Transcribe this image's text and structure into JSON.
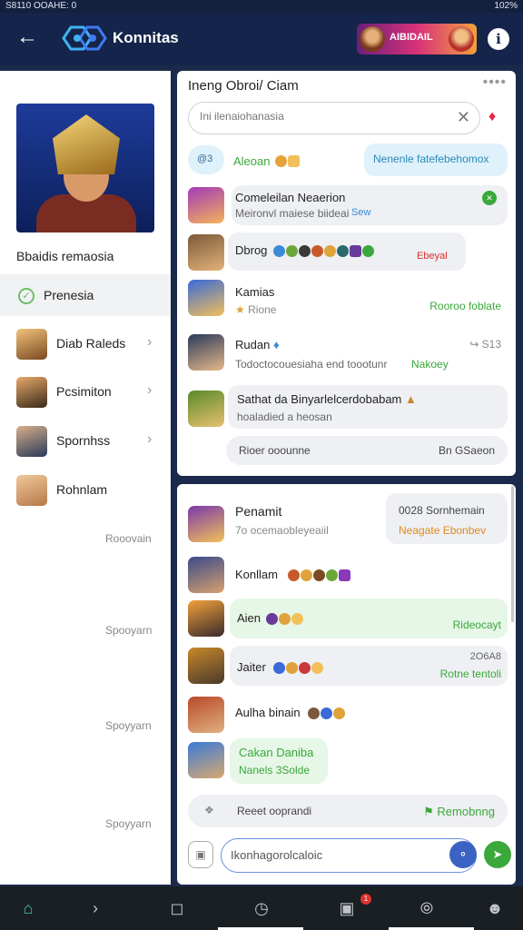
{
  "status_bar": {
    "left": "S8110 OOAHE: 0",
    "right": "102%"
  },
  "app_bar": {
    "title": "Konnitas",
    "banner_text": "AIBIDAIL",
    "info_glyph": "i"
  },
  "sidebar": {
    "profile_name": "Bbaidis remaosia",
    "active_item": "Prenesia",
    "items": [
      {
        "label": "Diab Raleds",
        "colors": [
          "#f1c27a",
          "#7a4a22"
        ]
      },
      {
        "label": "Pcsimiton",
        "colors": [
          "#e6a96a",
          "#3a2a1a"
        ]
      },
      {
        "label": "Spornhss",
        "colors": [
          "#d8b08a",
          "#2a3a5a"
        ]
      },
      {
        "label": "Rohnlam",
        "colors": [
          "#f0c89a",
          "#b7794a"
        ]
      }
    ],
    "meta": [
      "Rooovain",
      "Spooyarn",
      "Spoyyarn",
      "Spoyyarn"
    ]
  },
  "panel1": {
    "title": "Ineng Obroi/ Ciam",
    "search": {
      "value": "Ini ilenaiohanasia",
      "placeholder": "Ini ilenaiohanasia"
    },
    "rows": [
      {
        "avatar_glyph": "@3",
        "name": "Aleoan",
        "bubble": "Nenenle fatefebehomox"
      },
      {
        "name": "Comeleilan Neaerion",
        "sub": "Meironvl maiese biideai",
        "sub2": "Sew",
        "badge": "✕",
        "colors": [
          "#a23ab8",
          "#f4b35a"
        ]
      },
      {
        "name": "Dbrog",
        "extra": "Ebeyal",
        "colors": [
          "#7a5a3a",
          "#e4b27a"
        ]
      },
      {
        "name": "Kamias",
        "sub": "Rione",
        "extra": "Rooroo foblate",
        "colors": [
          "#3a6ad8",
          "#f2c05a"
        ]
      },
      {
        "name": "Rudan",
        "meta": "S13",
        "sub": "Todoctocouesiaha end toootunr",
        "extra": "Nakoey",
        "colors": [
          "#2a3a5a",
          "#e6b88a"
        ]
      },
      {
        "name": "Sathat da Binyarlelcerdobabam",
        "sub": "hoaladied a heosan",
        "colors": [
          "#5a8a2a",
          "#e8c070"
        ]
      }
    ],
    "footer": {
      "left": "Rioer ooounne",
      "right": "Bn GSaeon"
    }
  },
  "panel2": {
    "rows": [
      {
        "name": "Penamit",
        "sub": "7o ocemaobleyeaiil",
        "bubble_title": "0028 Sornhemain",
        "bubble_sub": "Neagate Ebonbev",
        "colors": [
          "#7a3aa8",
          "#f2c05a"
        ]
      },
      {
        "name": "Konllam",
        "colors": [
          "#3a4a8a",
          "#d8a070"
        ]
      },
      {
        "name": "Aien",
        "bubble": "Rideocayt",
        "colors": [
          "#f2a13c",
          "#3a2a2a"
        ]
      },
      {
        "name": "Jaiter",
        "meta": "2O6A8",
        "bubble": "Rotne tentoli",
        "colors": [
          "#c8882a",
          "#4a3a2a"
        ]
      },
      {
        "name": "Aulha binain",
        "colors": [
          "#b84a2a",
          "#e0b080"
        ]
      },
      {
        "name": "Cakan Daniba",
        "sub": "Nanels 3Solde",
        "colors": [
          "#3a7ad8",
          "#d8a870"
        ]
      }
    ],
    "footer": {
      "left": "Reeet ooprandi",
      "right": "Remobnng"
    },
    "composer": {
      "value": "Ikonhagorolcaloic",
      "placeholder": "Ikonhagorolcaloic"
    }
  },
  "bottom_nav": {
    "badge": "1"
  }
}
